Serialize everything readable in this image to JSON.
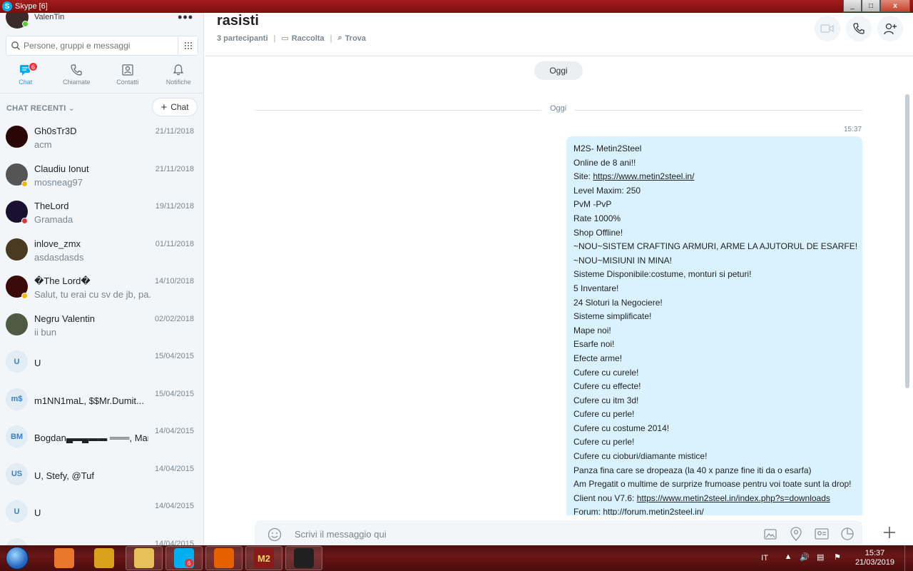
{
  "window": {
    "title": "Skype [6]",
    "app_icon_letter": "S",
    "controls": [
      "_",
      "□",
      "x"
    ]
  },
  "profile": {
    "name": "ValenTin",
    "status_color": "#5cc83a"
  },
  "search": {
    "placeholder": "Persone, gruppi e messaggi"
  },
  "nav": [
    {
      "label": "Chat",
      "icon": "chat-icon",
      "badge": "6",
      "active": true
    },
    {
      "label": "Chiamate",
      "icon": "phone-icon"
    },
    {
      "label": "Contatti",
      "icon": "contacts-icon"
    },
    {
      "label": "Notifiche",
      "icon": "bell-icon"
    }
  ],
  "recent": {
    "label": "CHAT RECENTI",
    "new_chat_label": "Chat"
  },
  "chats": [
    {
      "name": "Gh0sTr3D",
      "preview": "acm",
      "date": "21/11/2018",
      "avatar_color": "#2a0606"
    },
    {
      "name": "Claudiu Ionut",
      "preview": "mosneag97",
      "date": "21/11/2018",
      "avatar_color": "#555",
      "status_color": "#f2b600"
    },
    {
      "name": "TheLord",
      "preview": "Gramada",
      "date": "19/11/2018",
      "avatar_color": "#1a1030",
      "status_color": "#e2343b"
    },
    {
      "name": "inlove_zmx",
      "preview": "asdasdasds",
      "date": "01/11/2018",
      "avatar_color": "#4a3a22"
    },
    {
      "name": "�The Lord�",
      "preview": "Salut, tu erai cu sv de jb, pa...",
      "date": "14/10/2018",
      "avatar_color": "#3a0a0a",
      "status_color": "#f2b600"
    },
    {
      "name": "Negru Valentin",
      "preview": "ii bun",
      "date": "02/02/2018",
      "avatar_color": "#4f5a44"
    },
    {
      "name": "U",
      "preview": "",
      "date": "15/04/2015",
      "initials": "U"
    },
    {
      "name": "m1NN1maL, $$Mr.Dumit...",
      "preview": "",
      "date": "15/04/2015",
      "initials": "m$"
    },
    {
      "name": "Bogdan▄▬▄▬▬ ═══, Maria...",
      "preview": "",
      "date": "14/04/2015",
      "initials": "BM"
    },
    {
      "name": "U, Stefy, @Tuf",
      "preview": "",
      "date": "14/04/2015",
      "initials": "US"
    },
    {
      "name": "U",
      "preview": "",
      "date": "14/04/2015",
      "initials": "U"
    },
    {
      "name": "",
      "preview": "",
      "date": "14/04/2015",
      "initials": ""
    }
  ],
  "conversation": {
    "title": "rasisti",
    "participants": "3 partecipanti",
    "gallery_label": "Raccolta",
    "find_label": "Trova",
    "date_pill": "Oggi",
    "date_divider": "Oggi",
    "message_time": "15:37",
    "message_lines": [
      "M2S- Metin2Steel",
      "Online de 8 ani!!",
      "Site: |https://www.metin2steel.in/",
      "Level Maxim: 250",
      "PvM -PvP",
      "Rate 1000%",
      "Shop Offline!",
      "~NOU~SISTEM CRAFTING ARMURI, ARME LA AJUTORUL DE ESARFE!",
      "~NOU~MISIUNI IN MINA!",
      "Sisteme Disponibile:costume, monturi si peturi!",
      "5 Inventare!",
      "24 Sloturi la Negociere!",
      "Sisteme simplificate!",
      "Mape noi!",
      "Esarfe noi!",
      "Efecte arme!",
      "Cufere cu curele!",
      "Cufere cu effecte!",
      "Cufere cu itm 3d!",
      "Cufere cu perle!",
      "Cufere cu costume 2014!",
      "Cufere cu perle!",
      "Cufere cu cioburi/diamante mistice!",
      "Panza fina care se dropeaza (la 40 x panze fine iti da o esarfa)",
      "Am Pregatit o multime de surprize frumoase pentru voi toate sunt la drop!",
      "Client nou V7.6: |https://www.metin2steel.in/index.php?s=downloads",
      "Forum: http://forum.metin2steel.in/"
    ],
    "composer_placeholder": "Scrivi il messaggio qui"
  },
  "taskbar": {
    "apps": [
      {
        "name": "media-player-app",
        "color": "#e8762b",
        "pinned": false
      },
      {
        "name": "winamp-app",
        "color": "#d9a01c",
        "pinned": false
      },
      {
        "name": "file-explorer-app",
        "color": "#e6c15a",
        "pinned": true
      },
      {
        "name": "skype-app",
        "color": "#00aff0",
        "pinned": true,
        "badge": "6"
      },
      {
        "name": "firefox-app",
        "color": "#e66000",
        "pinned": true
      },
      {
        "name": "metin2-app",
        "color": "#8a1a1a",
        "pinned": true,
        "label": "M2"
      },
      {
        "name": "recorder-app",
        "color": "#202020",
        "pinned": true
      }
    ],
    "language": "IT",
    "time": "15:37",
    "date": "21/03/2019"
  }
}
